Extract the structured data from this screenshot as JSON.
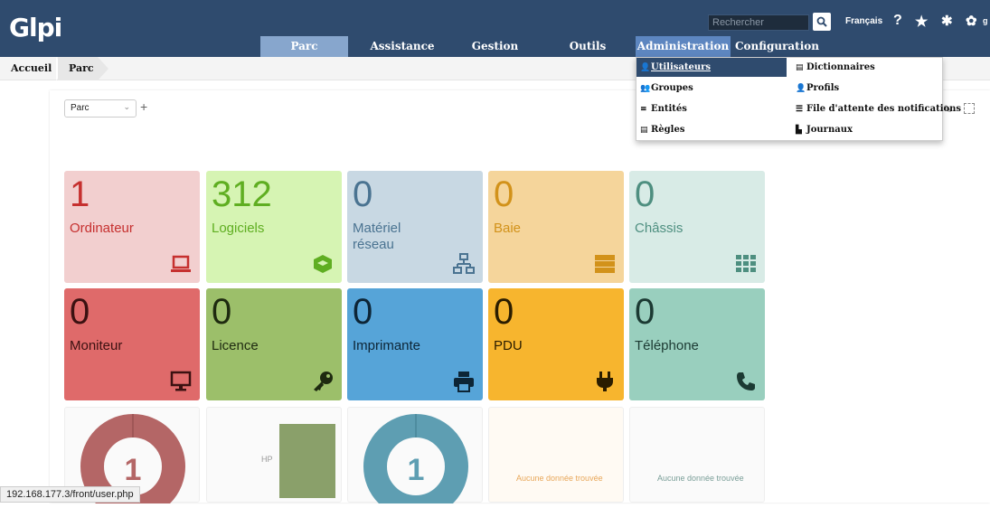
{
  "app": {
    "logo": "Glpi"
  },
  "header": {
    "search_placeholder": "Rechercher",
    "language": "Français",
    "user_partial": "g"
  },
  "nav": {
    "tabs": [
      "Parc",
      "Assistance",
      "Gestion",
      "Outils",
      "Administration",
      "Configuration"
    ]
  },
  "breadcrumb": [
    "Accueil",
    "Parc"
  ],
  "toolbar": {
    "selected_dashboard": "Parc"
  },
  "admin_menu": {
    "left": [
      "Utilisateurs",
      "Groupes",
      "Entités",
      "Règles"
    ],
    "right": [
      "Dictionnaires",
      "Profils",
      "File d'attente des notifications",
      "Journaux"
    ]
  },
  "tiles_row1": [
    {
      "count": "1",
      "label": "Ordinateur",
      "icon": "laptop-icon",
      "bg": "#f2cfcf",
      "fg": "#c6302f"
    },
    {
      "count": "312",
      "label": "Logiciels",
      "icon": "cube-icon",
      "bg": "#d6f4b3",
      "fg": "#5fae21"
    },
    {
      "count": "0",
      "label": "Matériel réseau",
      "icon": "network-icon",
      "bg": "#c8d8e3",
      "fg": "#4a7391"
    },
    {
      "count": "0",
      "label": "Baie",
      "icon": "server-icon",
      "bg": "#f5d59b",
      "fg": "#d2921a"
    },
    {
      "count": "0",
      "label": "Châssis",
      "icon": "grid-icon",
      "bg": "#d8ebe6",
      "fg": "#4e8f80"
    }
  ],
  "tiles_row2": [
    {
      "count": "0",
      "label": "Moniteur",
      "icon": "monitor-icon",
      "bg": "#df6a6a",
      "fg": "#3b1111"
    },
    {
      "count": "0",
      "label": "Licence",
      "icon": "key-icon",
      "bg": "#9cbf6a",
      "fg": "#1e2a10"
    },
    {
      "count": "0",
      "label": "Imprimante",
      "icon": "printer-icon",
      "bg": "#56a4d8",
      "fg": "#0d2536"
    },
    {
      "count": "0",
      "label": "PDU",
      "icon": "plug-icon",
      "bg": "#f7b52e",
      "fg": "#2b1d00"
    },
    {
      "count": "0",
      "label": "Téléphone",
      "icon": "phone-icon",
      "bg": "#99cfbe",
      "fg": "#1c3a33"
    }
  ],
  "charts": [
    {
      "type": "donut",
      "value": "1",
      "color": "#b46666"
    },
    {
      "type": "bar",
      "label": "HP",
      "value": 1,
      "color": "#8aa06a"
    },
    {
      "type": "donut",
      "value": "1",
      "color": "#5e9eb2"
    },
    {
      "type": "empty",
      "text": "Aucune donnée trouvée",
      "color": "#e8a75a"
    },
    {
      "type": "empty",
      "text": "Aucune donnée trouvée",
      "color": "#7a9e98"
    }
  ],
  "status_url": "192.168.177.3/front/user.php"
}
